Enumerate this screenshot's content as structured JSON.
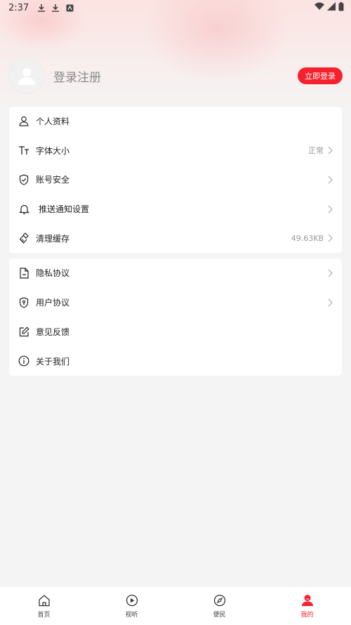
{
  "status_bar": {
    "time": "2:37",
    "left_icons": [
      "download-icon",
      "download-icon",
      "app-notification-icon"
    ],
    "right_icons": [
      "wifi-icon",
      "signal-icon",
      "battery-icon"
    ]
  },
  "profile": {
    "login_text": "登录注册",
    "login_button": "立即登录"
  },
  "settings_group_1": [
    {
      "label": "个人资料",
      "icon": "user-icon",
      "value": "",
      "chevron": false
    },
    {
      "label": "字体大小",
      "icon": "font-size-icon",
      "value": "正常",
      "chevron": true
    },
    {
      "label": "账号安全",
      "icon": "shield-check-icon",
      "value": "",
      "chevron": true
    },
    {
      "label": "推送通知设置",
      "icon": "bell-icon",
      "value": "",
      "chevron": true
    },
    {
      "label": "清理缓存",
      "icon": "brush-icon",
      "value": "49.63KB",
      "chevron": true
    }
  ],
  "settings_group_2": [
    {
      "label": "隐私协议",
      "icon": "document-icon",
      "chevron": true
    },
    {
      "label": "用户协议",
      "icon": "shield-lock-icon",
      "chevron": true
    },
    {
      "label": "意见反馈",
      "icon": "edit-icon",
      "chevron": false
    },
    {
      "label": "关于我们",
      "icon": "info-icon",
      "chevron": false
    }
  ],
  "tabbar": [
    {
      "label": "首页",
      "icon": "home-icon",
      "active": false
    },
    {
      "label": "视听",
      "icon": "play-icon",
      "active": false
    },
    {
      "label": "便民",
      "icon": "compass-icon",
      "active": false
    },
    {
      "label": "我的",
      "icon": "profile-icon",
      "active": true
    }
  ],
  "colors": {
    "accent": "#f5222d",
    "background": "#f4f4f4",
    "card": "#ffffff"
  }
}
